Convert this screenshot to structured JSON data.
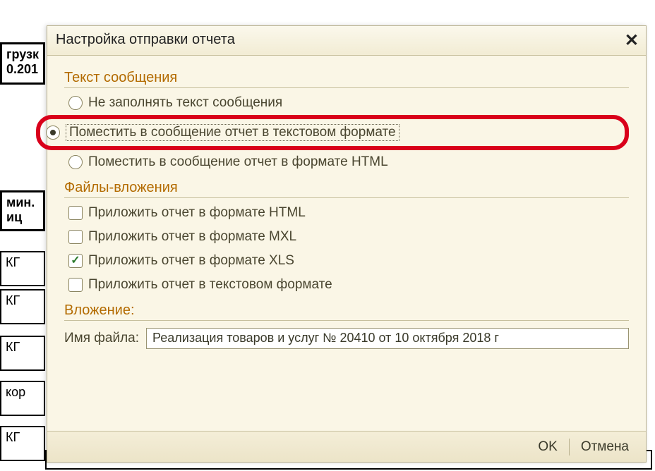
{
  "bg": {
    "cell_top1": "грузк",
    "cell_top2": "0.201",
    "cell_mid1": "мин.",
    "cell_mid2": "иц",
    "unit1": "КГ",
    "unit2": "КГ",
    "unit3": "КГ",
    "unit4": "кор",
    "unit5": "КГ"
  },
  "dialog": {
    "title": "Настройка отправки отчета",
    "section_text": "Текст сообщения",
    "radio1": "Не заполнять текст сообщения",
    "radio2": "Поместить в сообщение отчет в текстовом формате",
    "radio3": "Поместить в сообщение отчет в формате HTML",
    "section_files": "Файлы-вложения",
    "check1": "Приложить отчет в формате HTML",
    "check2": "Приложить отчет в формате MXL",
    "check3": "Приложить отчет в формате XLS",
    "check4": "Приложить отчет в текстовом формате",
    "section_attach": "Вложение:",
    "filename_label": "Имя файла:",
    "filename_value": "Реализация товаров и услуг № 20410 от 10 октября 2018 г",
    "ok": "OK",
    "cancel": "Отмена"
  }
}
